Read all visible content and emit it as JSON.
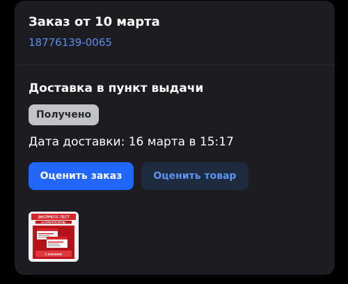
{
  "order": {
    "title": "Заказ от 10 марта",
    "number": "18776139-0065"
  },
  "delivery": {
    "title": "Доставка в пункт выдачи",
    "status": "Получено",
    "date": "Дата доставки: 16 марта в 15:17"
  },
  "actions": {
    "rate_order": "Оценить заказ",
    "rate_product": "Оценить товар"
  },
  "product": {
    "image_brand": "ЭКСПРЕСС-ТЕСТ",
    "image_caption": "на СКРЫТУЮ КРОВЬ",
    "image_pack": "2 упаковки"
  },
  "colors": {
    "background": "#000000",
    "card": "#1c1c21",
    "link": "#5b8def",
    "primary_button": "#2166ff",
    "secondary_button": "#1e2a3d",
    "status_badge": "#c2c3c9"
  }
}
